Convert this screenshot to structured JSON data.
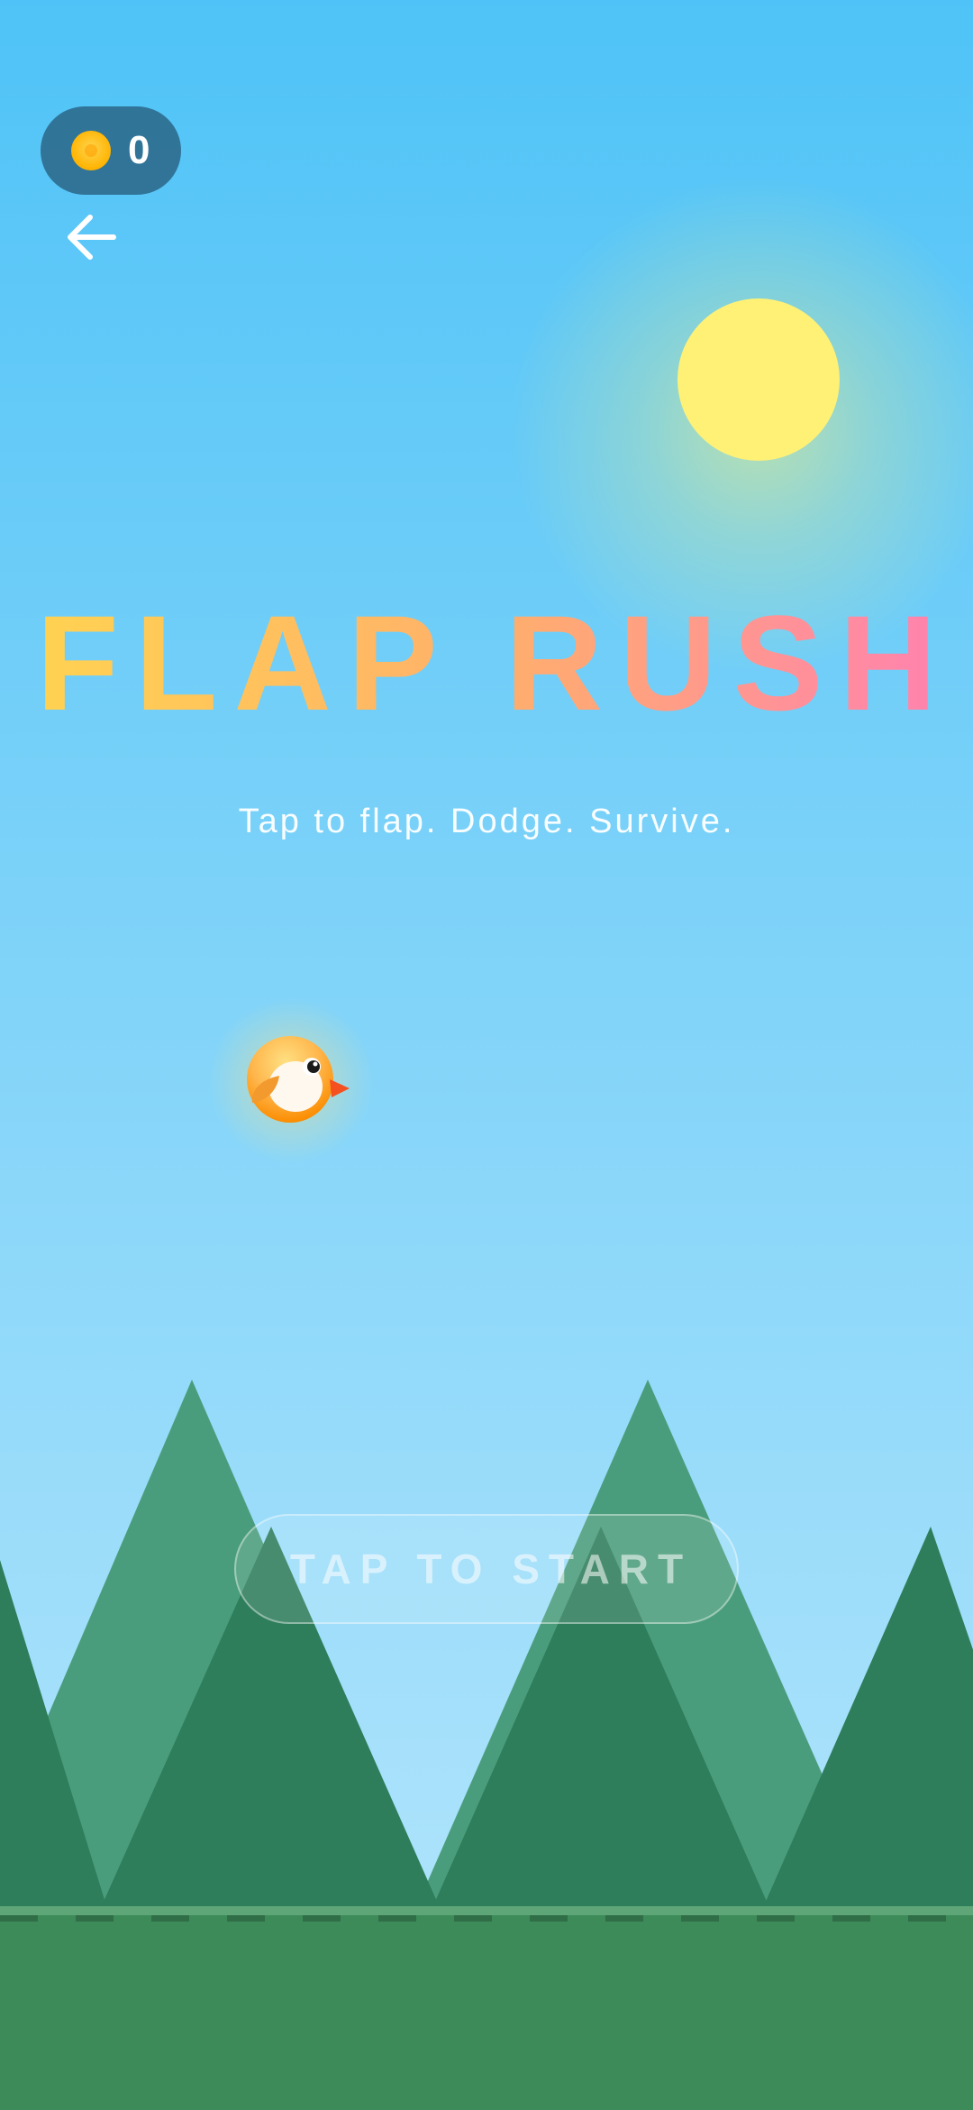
{
  "hud": {
    "coin_icon": "coin-icon",
    "coins": "0",
    "back_icon": "arrow-left-icon"
  },
  "game": {
    "title": "FLAP RUSH",
    "subtitle": "Tap to flap. Dodge. Survive.",
    "start_label": "TAP TO START"
  },
  "colors": {
    "sky_top": "#4fc3f7",
    "sky_bottom": "#b3e5fc",
    "sun": "#fff176",
    "title_gradient_start": "#ffd54f",
    "title_gradient_end": "#ff7fb3",
    "mountain_back": "#4a9d7c",
    "mountain_front": "#2e7d5b",
    "ground": "#3d8b58"
  }
}
